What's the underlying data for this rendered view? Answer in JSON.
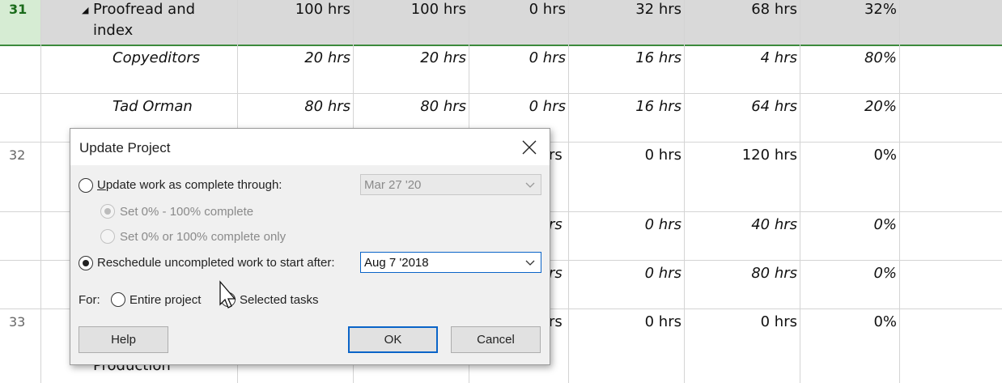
{
  "grid": {
    "rows": [
      {
        "id": "31",
        "name_lines": [
          "Proofread and",
          "index"
        ],
        "values": [
          "100 hrs",
          "100 hrs",
          "0 hrs",
          "32 hrs",
          "68 hrs",
          "32%"
        ],
        "italic": false,
        "selected": true,
        "has_arrow": true
      },
      {
        "id": "",
        "name_lines": [
          "Copyeditors"
        ],
        "values": [
          "20 hrs",
          "20 hrs",
          "0 hrs",
          "16 hrs",
          "4 hrs",
          "80%"
        ],
        "italic": true
      },
      {
        "id": "",
        "name_lines": [
          "Tad Orman"
        ],
        "values": [
          "80 hrs",
          "80 hrs",
          "0 hrs",
          "16 hrs",
          "64 hrs",
          "20%"
        ],
        "italic": true
      },
      {
        "id": "32",
        "partial": "rs",
        "values_visible": [
          "0 hrs",
          "120 hrs",
          "0%"
        ],
        "italic": false
      },
      {
        "id": "",
        "partial": "rs",
        "values_visible": [
          "0 hrs",
          "40 hrs",
          "0%"
        ],
        "italic": true
      },
      {
        "id": "",
        "partial": "rs",
        "values_visible": [
          "0 hrs",
          "80 hrs",
          "0%"
        ],
        "italic": true
      },
      {
        "id": "33",
        "name_lines": [
          "Production"
        ],
        "partial": "rs",
        "values_visible": [
          "0 hrs",
          "0 hrs",
          "0%"
        ],
        "italic": false
      }
    ]
  },
  "dialog": {
    "title": "Update Project",
    "update_work_label": "Update work as complete through:",
    "update_work_date": "Mar 27 '20",
    "set_pct_range_label": "Set 0% - 100% complete",
    "set_pct_only_label": "Set 0% or 100% complete only",
    "reschedule_label": "Reschedule uncompleted work to start after:",
    "reschedule_date": "Aug 7 '2018",
    "for_label": "For:",
    "entire_project_label": "Entire project",
    "selected_tasks_label": "Selected tasks",
    "help_label": "Help",
    "ok_label": "OK",
    "cancel_label": "Cancel"
  },
  "colors": {
    "header_row": "#d9d9d9",
    "selected_id": "#d6ecd3",
    "selection_border": "#3c8a3c",
    "dialog_bg": "#f0f0f0",
    "accent": "#0a64c8"
  }
}
